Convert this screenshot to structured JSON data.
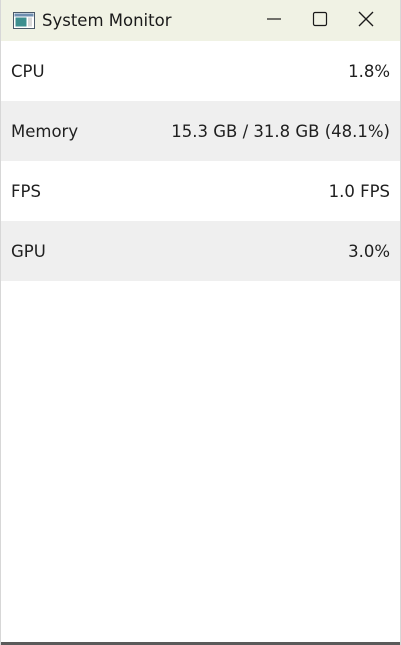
{
  "window": {
    "title": "System Monitor",
    "app_icon": "window-app-icon",
    "controls": {
      "minimize_icon": "minimize-icon",
      "maximize_icon": "maximize-icon",
      "close_icon": "close-icon"
    }
  },
  "colors": {
    "titlebar_bg": "#f0f2e4",
    "row_alt_bg": "#efefef",
    "text": "#1f1f1f"
  },
  "metrics": [
    {
      "label": "CPU",
      "value": "1.8%"
    },
    {
      "label": "Memory",
      "value": "15.3 GB / 31.8 GB (48.1%)"
    },
    {
      "label": "FPS",
      "value": "1.0 FPS"
    },
    {
      "label": "GPU",
      "value": "3.0%"
    }
  ]
}
